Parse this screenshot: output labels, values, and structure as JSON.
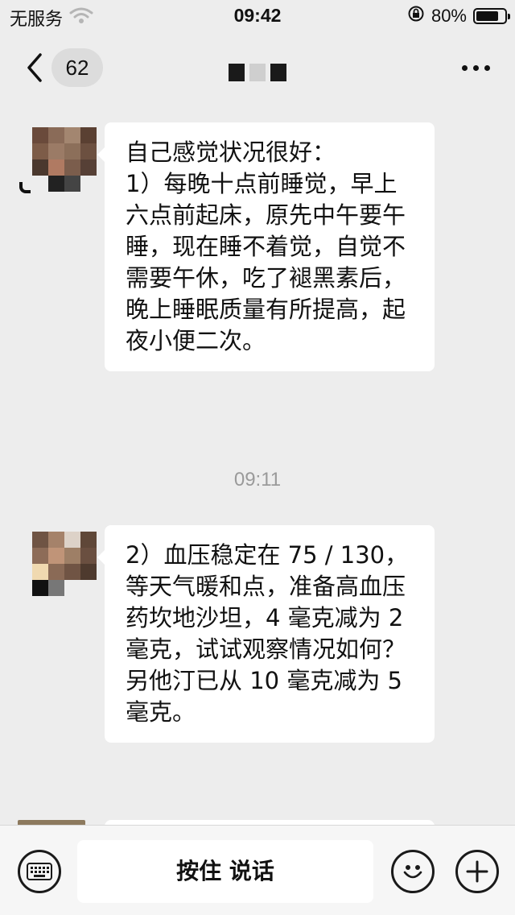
{
  "status_bar": {
    "carrier": "无服务",
    "time": "09:42",
    "battery": "80%",
    "battery_level": 0.8,
    "icons": [
      "wifi-icon",
      "orientation-lock-icon",
      "battery-icon"
    ]
  },
  "nav": {
    "unread_count": "62",
    "title": "",
    "icons": [
      "back-chevron-icon",
      "more-icon"
    ]
  },
  "messages": [
    {
      "text": "自己感觉状况很好：\n1）每晚十点前睡觉，早上六点前起床，原先中午要午睡，现在睡不着觉，自觉不需要午休，吃了褪黑素后，晚上睡眠质量有所提高，起夜小便二次。"
    },
    {
      "text": "2）血压稳定在 75 / 130，等天气暖和点，准备高血压药坎地沙坦，4 毫克减为 2 毫克，试试观察情况如何？\n另他汀已从 10 毫克减为 5 毫克。"
    }
  ],
  "timestamp": "09:11",
  "input_bar": {
    "voice_label": "按住 说话",
    "icons": [
      "keyboard-icon",
      "emoji-icon",
      "plus-icon"
    ]
  },
  "colors": {
    "background": "#ededed",
    "bubble": "#ffffff",
    "timestamp": "#9a9a9a"
  }
}
